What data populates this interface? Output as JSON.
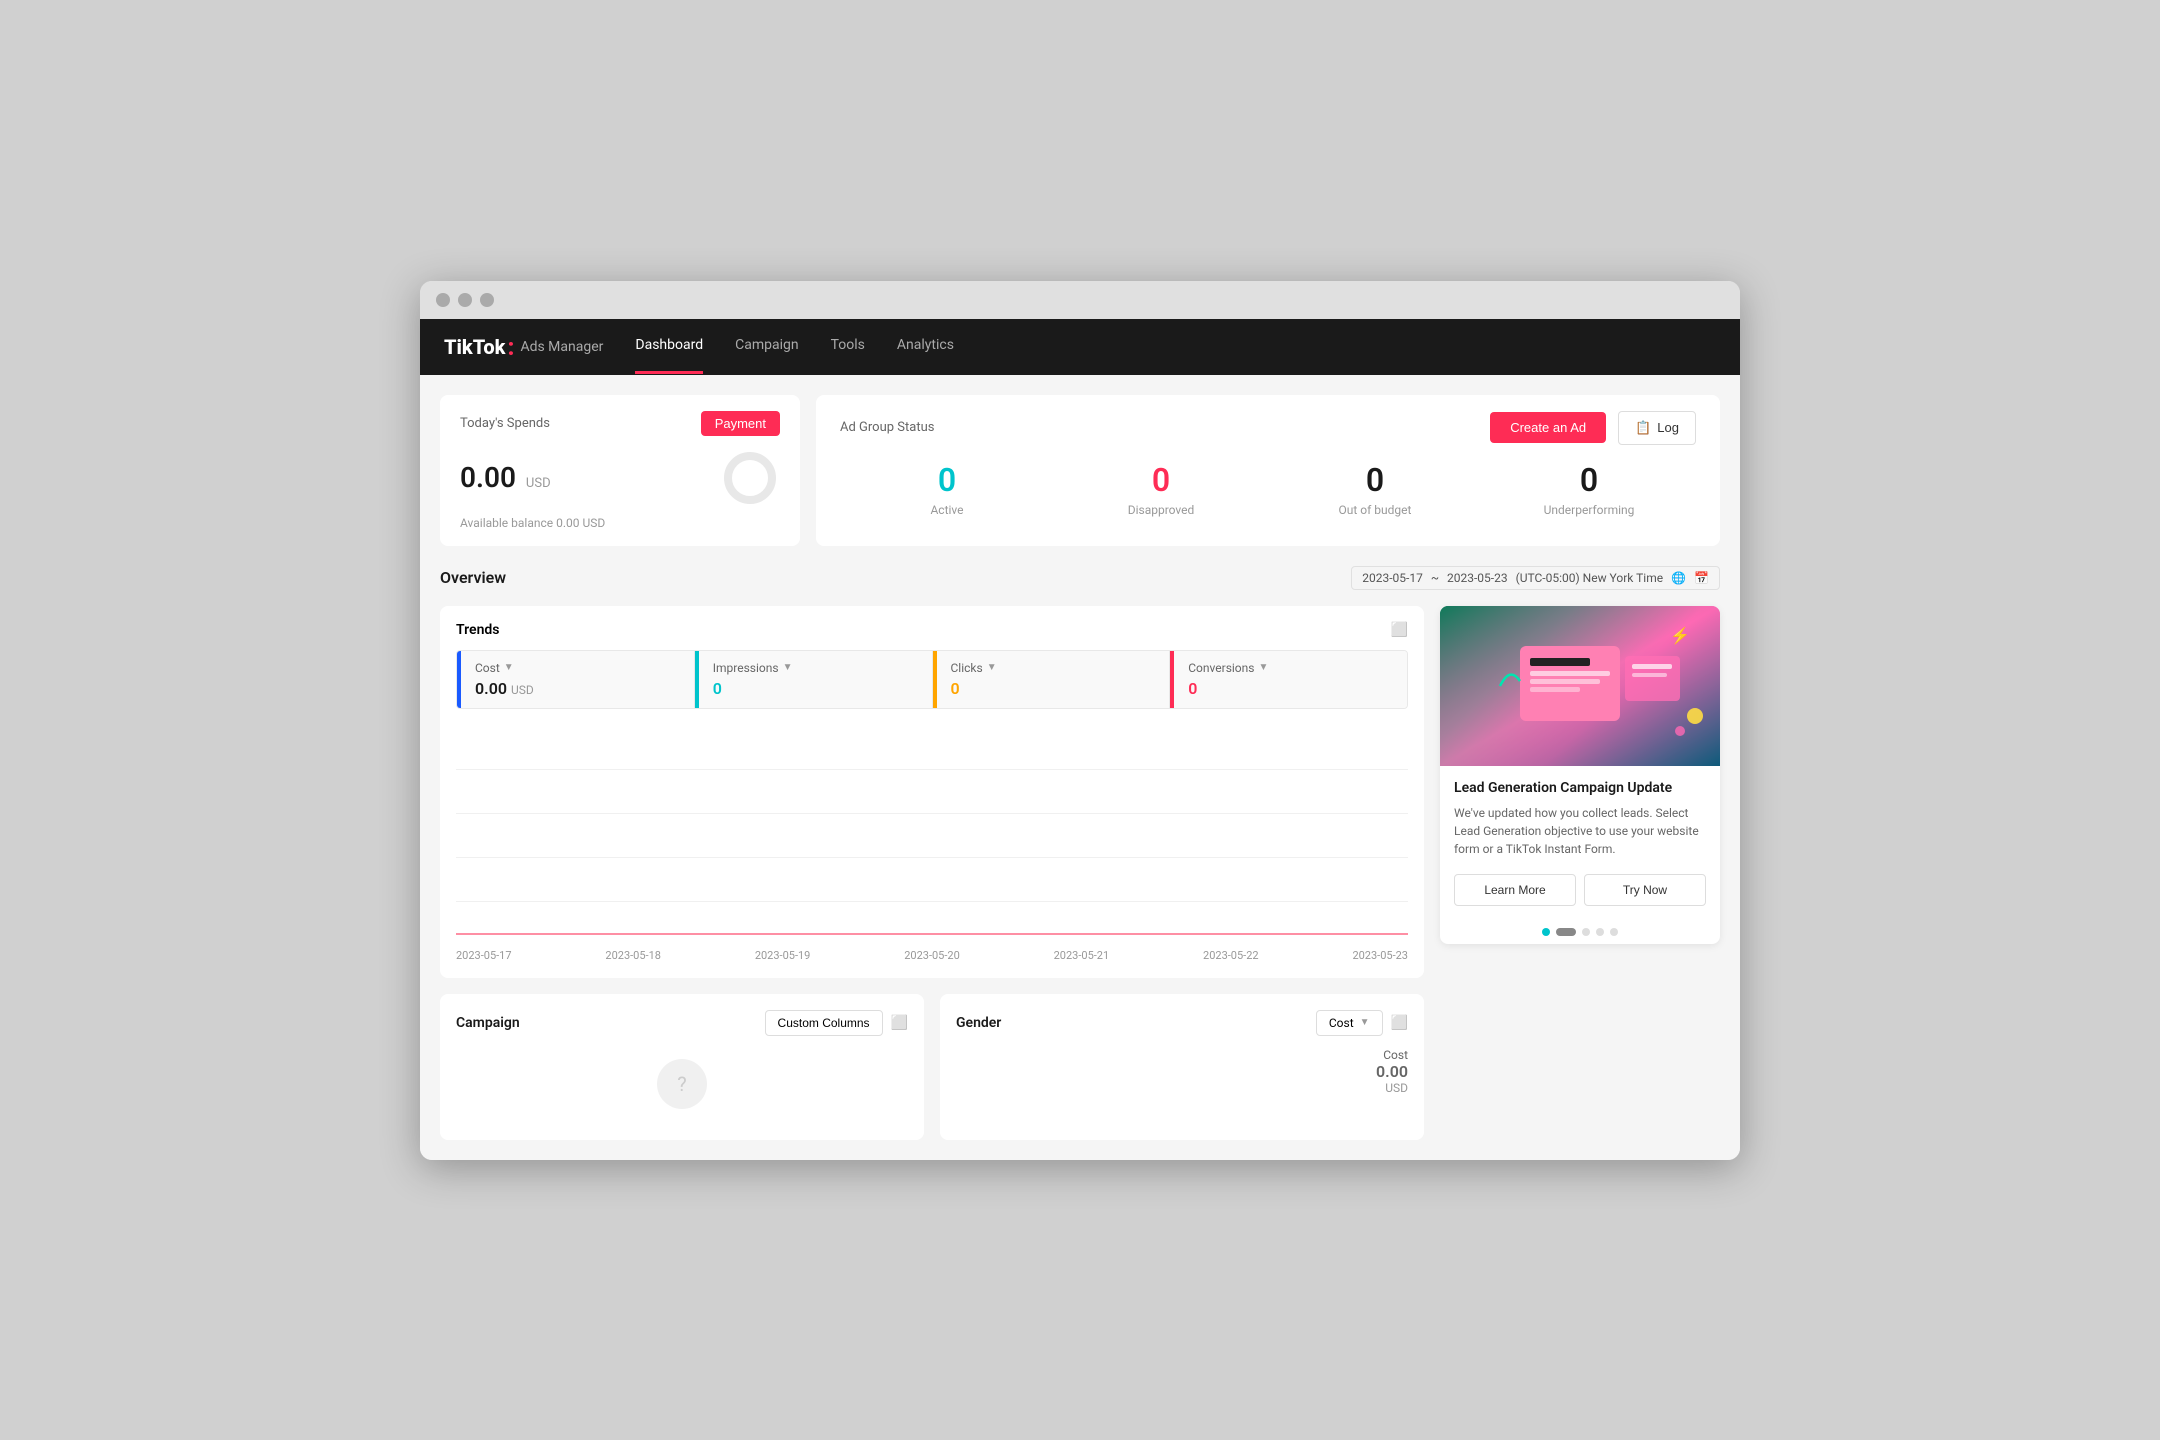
{
  "window": {
    "title": "TikTok Ads Manager"
  },
  "logo": {
    "brand": "TikTok",
    "dot": ":",
    "sub": "Ads Manager"
  },
  "nav": {
    "items": [
      {
        "id": "dashboard",
        "label": "Dashboard",
        "active": true
      },
      {
        "id": "campaign",
        "label": "Campaign",
        "active": false
      },
      {
        "id": "tools",
        "label": "Tools",
        "active": false
      },
      {
        "id": "analytics",
        "label": "Analytics",
        "active": false
      }
    ]
  },
  "spends": {
    "title": "Today's Spends",
    "payment_label": "Payment",
    "amount": "0.00",
    "currency": "USD",
    "balance_label": "Available balance 0.00 USD"
  },
  "ad_group_status": {
    "title": "Ad Group Status",
    "metrics": [
      {
        "id": "active",
        "value": "0",
        "label": "Active",
        "color": "cyan"
      },
      {
        "id": "disapproved",
        "value": "0",
        "label": "Disapproved",
        "color": "red"
      },
      {
        "id": "out_of_budget",
        "value": "0",
        "label": "Out of budget",
        "color": "black"
      },
      {
        "id": "underperforming",
        "value": "0",
        "label": "Underperforming",
        "color": "black"
      }
    ]
  },
  "header_actions": {
    "create_ad_label": "Create an Ad",
    "log_label": "Log"
  },
  "overview": {
    "title": "Overview",
    "date_start": "2023-05-17",
    "date_end": "2023-05-23",
    "timezone": "(UTC-05:00) New York Time"
  },
  "trends": {
    "title": "Trends",
    "metrics": [
      {
        "id": "cost",
        "label": "Cost",
        "value": "0.00",
        "unit": "USD",
        "color": "normal",
        "border_color": "#1a5aff"
      },
      {
        "id": "impressions",
        "label": "Impressions",
        "value": "0",
        "color": "cyan",
        "border_color": "#00c4cc"
      },
      {
        "id": "clicks",
        "label": "Clicks",
        "value": "0",
        "color": "orange",
        "border_color": "#ffa500"
      },
      {
        "id": "conversions",
        "label": "Conversions",
        "value": "0",
        "color": "red",
        "border_color": "#fe2c55"
      }
    ],
    "dates": [
      "2023-05-17",
      "2023-05-18",
      "2023-05-19",
      "2023-05-20",
      "2023-05-21",
      "2023-05-22",
      "2023-05-23"
    ]
  },
  "ad_card": {
    "title": "Lead Generation Campaign Update",
    "body": "We've updated how you collect leads. Select Lead Generation objective to use your website form or a TikTok Instant Form.",
    "learn_more_label": "Learn More",
    "try_now_label": "Try Now",
    "dots": [
      {
        "active": false,
        "color": "#00c4cc"
      },
      {
        "active": true,
        "color": "#888"
      },
      {
        "active": false,
        "color": "#ddd"
      },
      {
        "active": false,
        "color": "#ddd"
      },
      {
        "active": false,
        "color": "#ddd"
      }
    ]
  },
  "campaign": {
    "title": "Campaign",
    "custom_columns_label": "Custom Columns"
  },
  "gender": {
    "title": "Gender",
    "cost_label": "Cost",
    "cost_value": "0.00",
    "cost_currency": "USD"
  }
}
